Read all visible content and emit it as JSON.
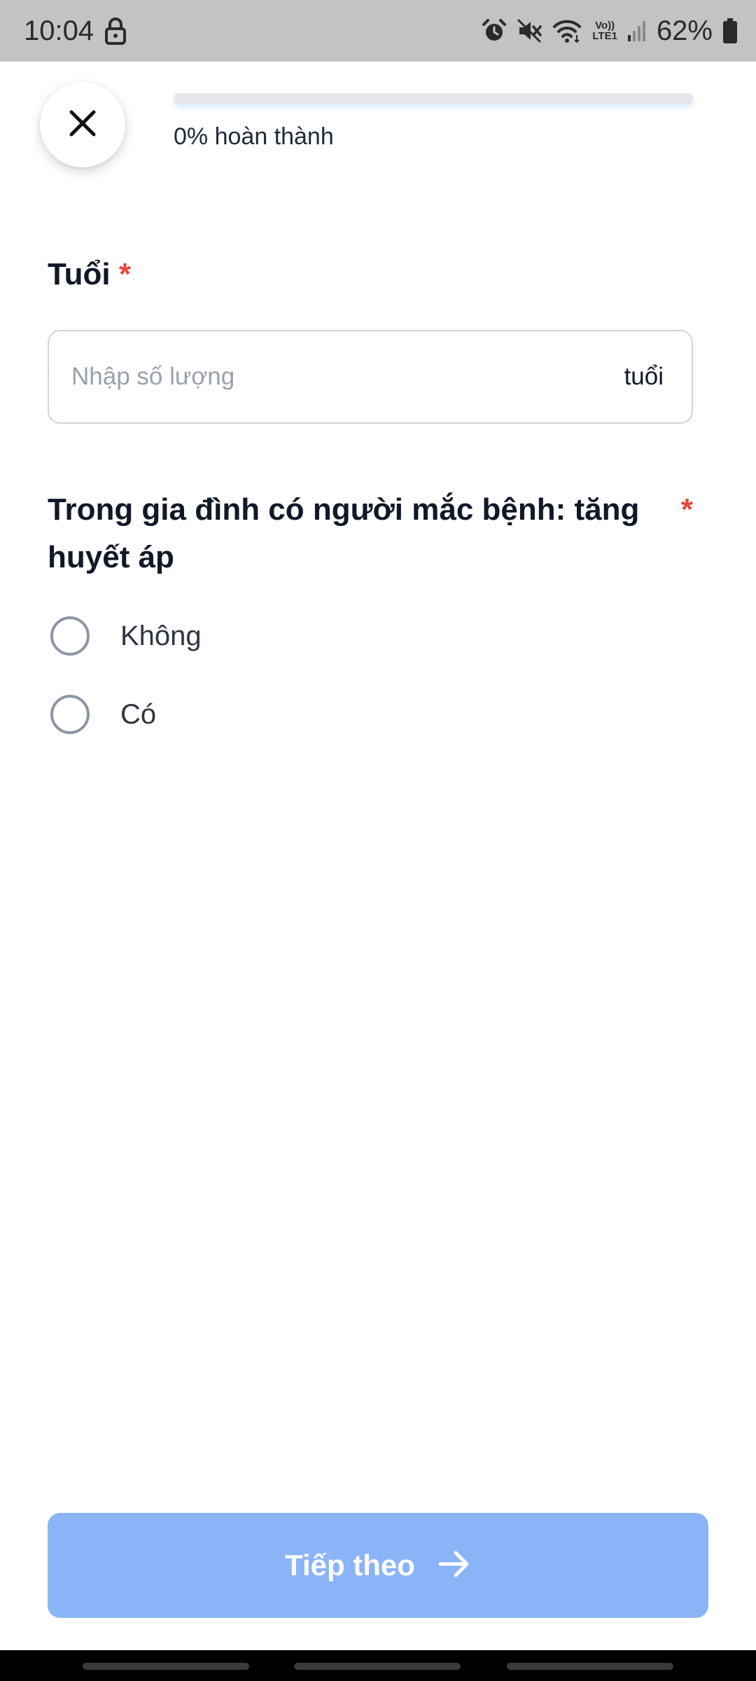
{
  "status_bar": {
    "time": "10:04",
    "lte_line1": "Vo))",
    "lte_line2": "LTE1",
    "battery": "62%"
  },
  "header": {
    "progress_label": "0% hoàn thành",
    "progress_value": 0
  },
  "question_age": {
    "title": "Tuổi",
    "required_mark": "*",
    "placeholder": "Nhập số lượng",
    "unit": "tuổi"
  },
  "question_family": {
    "title": "Trong gia đình có người mắc bệnh: tăng huyết áp",
    "required_mark": "*",
    "options": [
      {
        "label": "Không"
      },
      {
        "label": "Có"
      }
    ]
  },
  "footer": {
    "next_label": "Tiếp theo"
  },
  "colors": {
    "accent": "#3b82f6",
    "button_disabled": "#8ab4f8",
    "required": "#e5483f"
  }
}
